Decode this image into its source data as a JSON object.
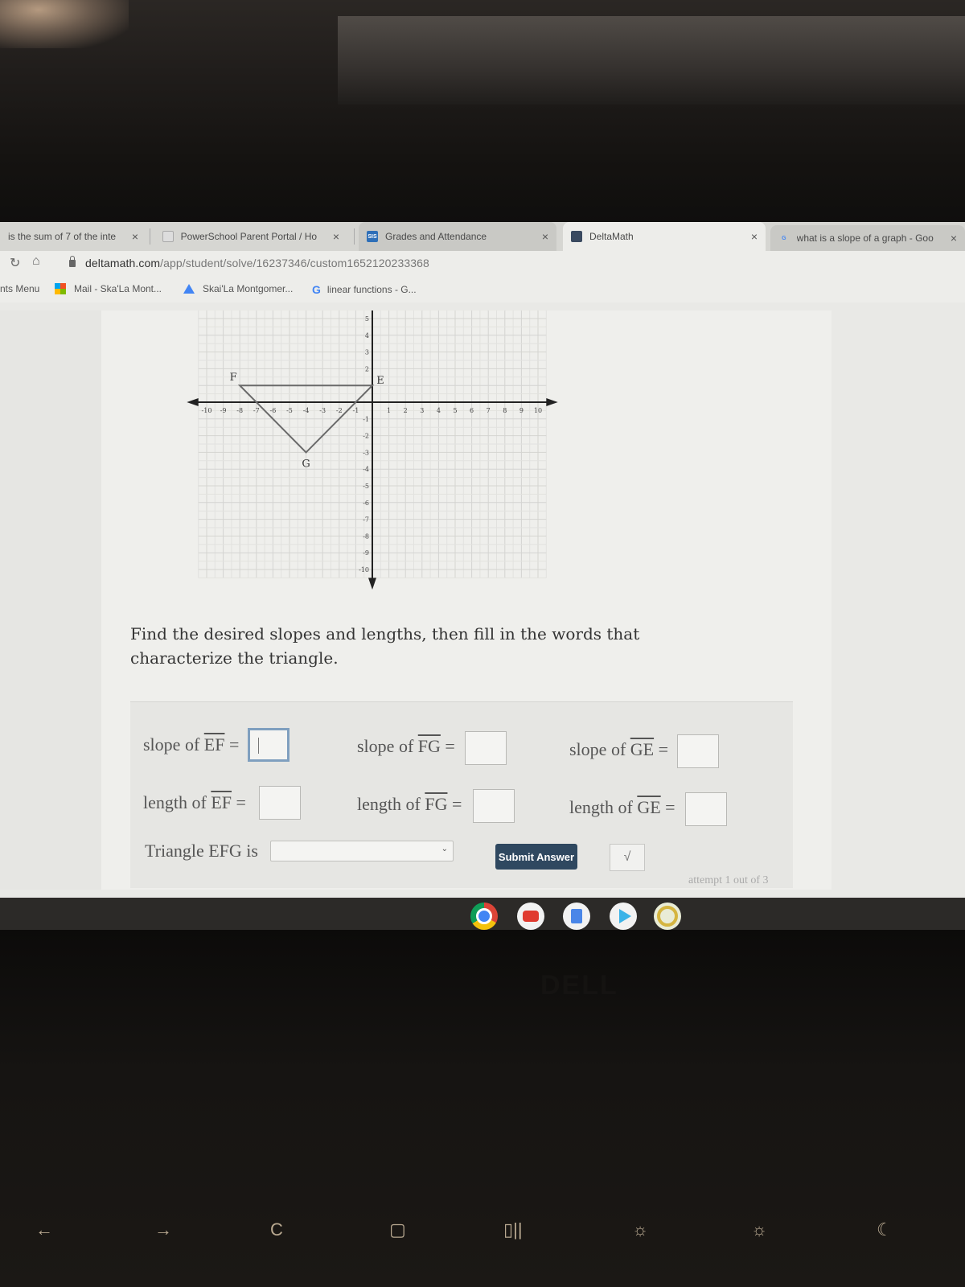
{
  "browser": {
    "tabs": [
      {
        "title": "is the sum of 7 of the inte",
        "favicon": "google-icon",
        "active": false
      },
      {
        "title": "PowerSchool Parent Portal / Ho",
        "favicon": "powerschool-icon",
        "active": false
      },
      {
        "title": "Grades and Attendance",
        "favicon": "sis-icon",
        "favicon_text": "SIS",
        "active": false
      },
      {
        "title": "DeltaMath",
        "favicon": "deltamath-icon",
        "active": true
      },
      {
        "title": "what is a slope of a graph - Goo",
        "favicon": "google-icon",
        "active": false
      }
    ],
    "close_glyph": "×",
    "url": {
      "host": "deltamath.com",
      "path": "/app/student/solve/16237346/custom1652120233368"
    },
    "bookmarks": [
      {
        "label": "nts Menu",
        "icon": "none"
      },
      {
        "label": "Mail - Ska'La Mont...",
        "icon": "microsoft-icon"
      },
      {
        "label": "Skai'La Montgomer...",
        "icon": "drive-icon"
      },
      {
        "label": "linear functions - G...",
        "icon": "google-icon"
      }
    ]
  },
  "problem": {
    "graph": {
      "x_range": [
        -10,
        10
      ],
      "y_range": [
        -10,
        5
      ],
      "x_ticks": [
        -10,
        -9,
        -8,
        -7,
        -6,
        -5,
        -4,
        -3,
        -2,
        -1,
        1,
        2,
        3,
        4,
        5,
        6,
        7,
        8,
        9,
        10
      ],
      "y_ticks": [
        5,
        4,
        3,
        2,
        -1,
        -2,
        -3,
        -4,
        -5,
        -6,
        -7,
        -8,
        -9,
        -10
      ],
      "points": [
        {
          "label": "E",
          "x": 0,
          "y": 1
        },
        {
          "label": "F",
          "x": -8,
          "y": 1
        },
        {
          "label": "G",
          "x": -4,
          "y": -3
        }
      ]
    },
    "prompt": "Find the desired slopes and lengths, then fill in the words that characterize the triangle.",
    "fields": {
      "slope_ef": {
        "prefix": "slope of ",
        "segment": "EF",
        "suffix": " =",
        "value": ""
      },
      "slope_fg": {
        "prefix": "slope of ",
        "segment": "FG",
        "suffix": " =",
        "value": ""
      },
      "slope_ge": {
        "prefix": "slope of ",
        "segment": "GE",
        "suffix": " =",
        "value": ""
      },
      "length_ef": {
        "prefix": "length of ",
        "segment": "EF",
        "suffix": " =",
        "value": ""
      },
      "length_fg": {
        "prefix": "length of ",
        "segment": "FG",
        "suffix": " =",
        "value": ""
      },
      "length_ge": {
        "prefix": "length of ",
        "segment": "GE",
        "suffix": " =",
        "value": ""
      }
    },
    "triangle_label": "Triangle EFG is",
    "triangle_select_value": "",
    "submit_label": "Submit Answer",
    "sqrt_label": "√",
    "attempt_text": "attempt 1 out of 3"
  },
  "shelf": {
    "apps": [
      "chrome-icon",
      "youtube-icon",
      "docs-icon",
      "play-store-icon",
      "app-icon"
    ]
  },
  "keyboard": {
    "brand": "DELL",
    "keys": [
      "←",
      "→",
      "C",
      "▢",
      "▯||",
      "☼",
      "☼",
      "☾"
    ]
  }
}
